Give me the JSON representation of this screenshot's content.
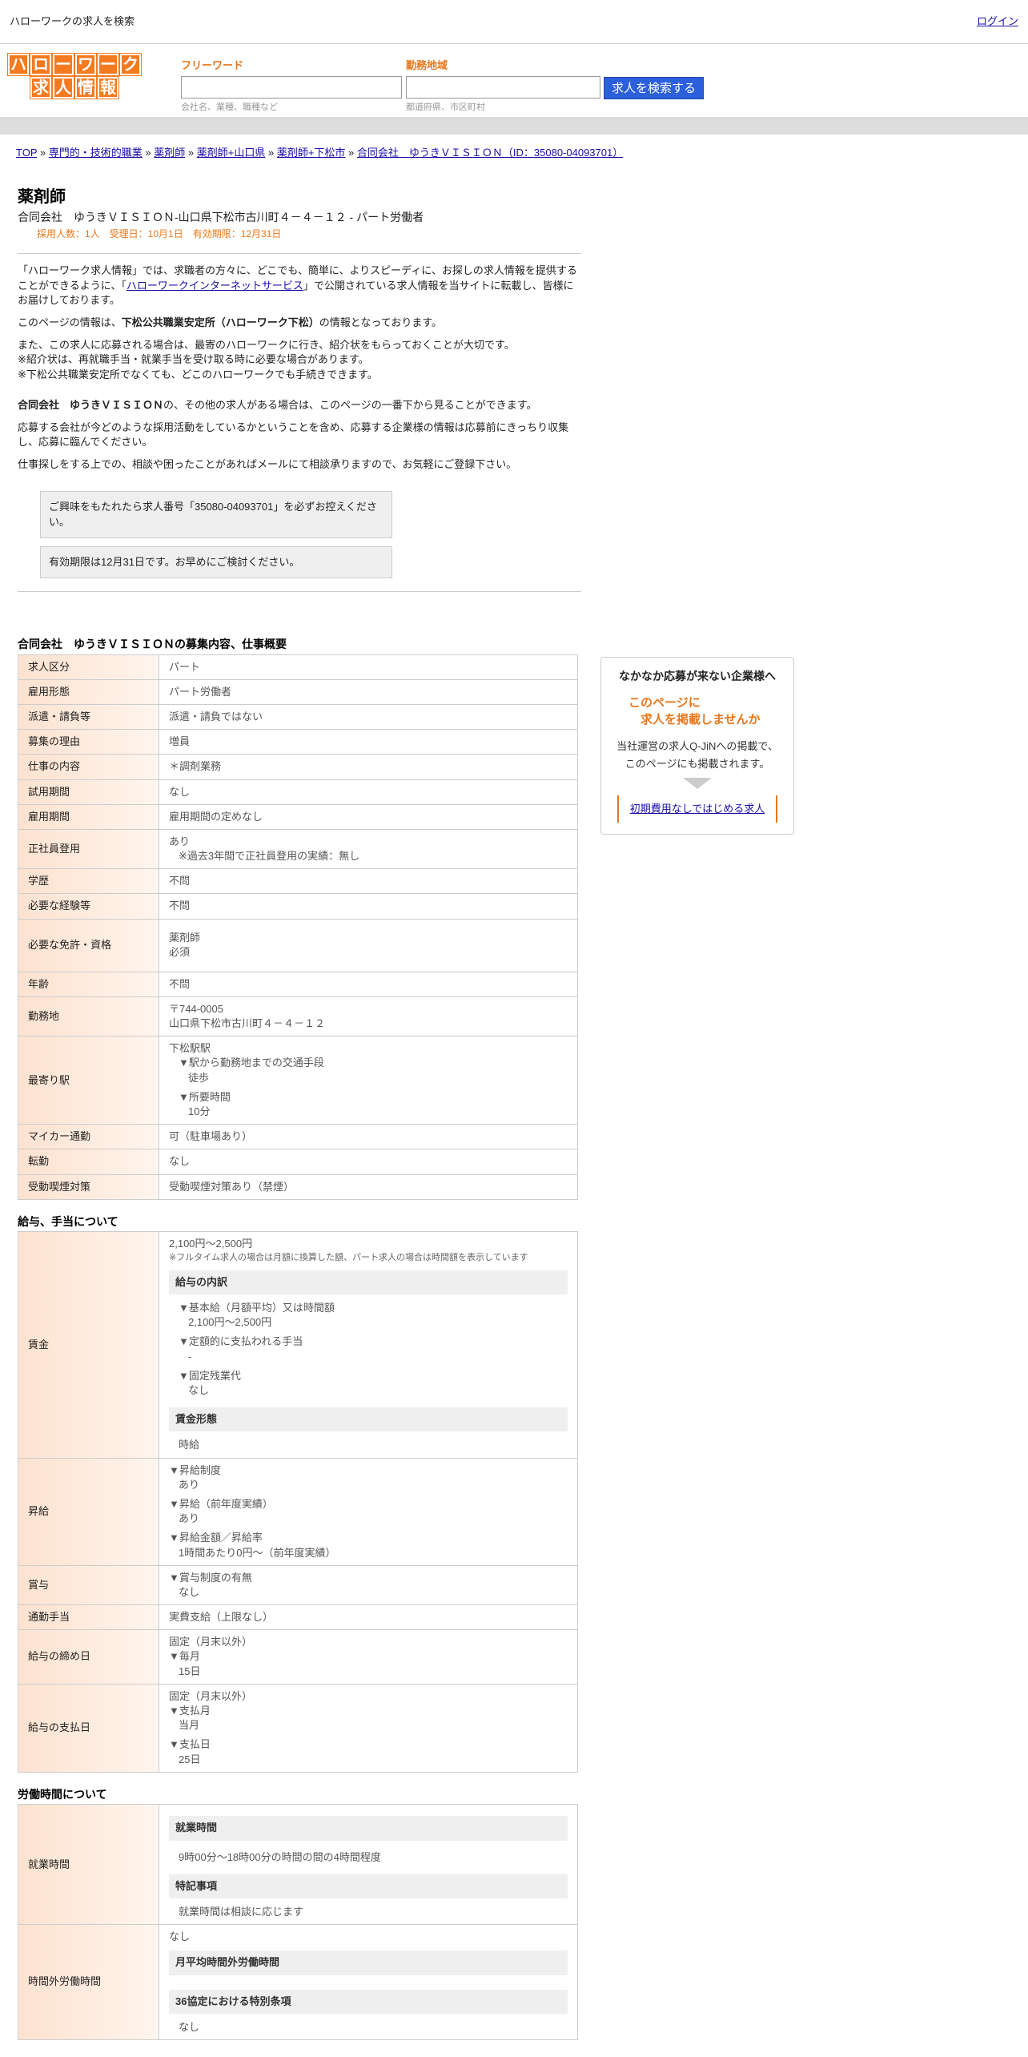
{
  "topbar": {
    "title": "ハローワークの求人を検索",
    "login": "ログイン"
  },
  "logo": {
    "row1": [
      "ハ",
      "ロ",
      "ー",
      "ワ",
      "ー",
      "ク"
    ],
    "row2": [
      "求",
      "人",
      "情",
      "報"
    ]
  },
  "search": {
    "freeword_label": "フリーワード",
    "freeword_value": "",
    "freeword_hint": "会社名、業種、職種など",
    "area_label": "勤務地域",
    "area_value": "",
    "area_hint": "都道府県、市区町村",
    "button": "求人を検索する"
  },
  "breadcrumb": {
    "items": [
      "TOP",
      "専門的・技術的職業",
      "薬剤師",
      "薬剤師+山口県",
      "薬剤師+下松市",
      "合同会社　ゆうきＶＩＳＩＯＮ（ID：35080-04093701）"
    ],
    "sep": "»"
  },
  "job": {
    "title": "薬剤師",
    "subtitle": "合同会社　ゆうきＶＩＳＩＯＮ-山口県下松市古川町４－４－１２ - パート労働者",
    "meta": "採用人数：1人　受理日：10月1日　有効期限：12月31日"
  },
  "intro": {
    "p1_a": "「ハローワーク求人情報」では、求職者の方々に、どこでも、簡単に、よりスピーディに、お探しの求人情報を提供することができるように、「",
    "p1_link": "ハローワークインターネットサービス",
    "p1_b": "」で公開されている求人情報を当サイトに転載し、皆様にお届けしております。",
    "p2_a": "このページの情報は、",
    "p2_bold": "下松公共職業安定所（ハローワーク下松）",
    "p2_b": "の情報となっております。",
    "p3_1": "また、この求人に応募される場合は、最寄のハローワークに行き、紹介状をもらっておくことが大切です。",
    "p3_2": "※紹介状は、再就職手当・就業手当を受け取る時に必要な場合があります。",
    "p3_3": "※下松公共職業安定所でなくても、どこのハローワークでも手続きできます。",
    "p4_bold": "合同会社　ゆうきＶＩＳＩＯＮ",
    "p4_b": "の、その他の求人がある場合は、このページの一番下から見ることができます。",
    "p5": "応募する会社が今どのような採用活動をしているかということを含め、応募する企業様の情報は応募前にきっちり収集し、応募に臨んでください。",
    "p6": "仕事探しをする上での、相談や困ったことがあればメールにて相談承りますので、お気軽にご登録下さい。",
    "notice1": "ご興味をもたれたら求人番号「35080-04093701」を必ずお控えください。",
    "notice2": "有効期限は12月31日です。お早めにご検討ください。"
  },
  "overview": {
    "heading": "合同会社　ゆうきＶＩＳＩＯＮの募集内容、仕事概要",
    "rows": [
      {
        "k": "求人区分",
        "v": "パート"
      },
      {
        "k": "雇用形態",
        "v": "パート労働者"
      },
      {
        "k": "派遣・請負等",
        "v": "派遣・請負ではない"
      },
      {
        "k": "募集の理由",
        "v": "増員"
      },
      {
        "k": "仕事の内容",
        "v": "＊調剤業務"
      },
      {
        "k": "試用期間",
        "v": "なし"
      },
      {
        "k": "雇用期間",
        "v": "雇用期間の定めなし"
      }
    ],
    "seishain_k": "正社員登用",
    "seishain_v1": "あり",
    "seishain_v2": "※過去3年間で正社員登用の実績：無し",
    "rows2": [
      {
        "k": "学歴",
        "v": "不問"
      },
      {
        "k": "必要な経験等",
        "v": "不問"
      }
    ],
    "menkyo_k": "必要な免許・資格",
    "menkyo_v1": "薬剤師",
    "menkyo_v2": "必須",
    "nenrei_k": "年齢",
    "nenrei_v": "不問",
    "kinmu_k": "勤務地",
    "kinmu_v1": "〒744-0005",
    "kinmu_v2": "山口県下松市古川町４－４－１２",
    "eki_k": "最寄り駅",
    "eki_v1": "下松駅駅",
    "eki_v2": "▼駅から勤務地までの交通手段",
    "eki_v3": "徒歩",
    "eki_v4": "▼所要時間",
    "eki_v5": "10分",
    "rows3": [
      {
        "k": "マイカー通勤",
        "v": "可（駐車場あり）"
      },
      {
        "k": "転勤",
        "v": "なし"
      },
      {
        "k": "受動喫煙対策",
        "v": "受動喫煙対策あり（禁煙）"
      }
    ]
  },
  "salary": {
    "heading": "給与、手当について",
    "chingin_k": "賃金",
    "chingin_v1": "2,100円〜2,500円",
    "chingin_note": "※フルタイム求人の場合は月額に換算した額、パート求人の場合は時間額を表示しています",
    "uchiwake_h": "給与の内訳",
    "u1": "▼基本給（月額平均）又は時間額",
    "u1v": "2,100円〜2,500円",
    "u2": "▼定額的に支払われる手当",
    "u2v": "-",
    "u3": "▼固定残業代",
    "u3v": "なし",
    "keitai_h": "賃金形態",
    "keitai_v": "時給",
    "shokyu_k": "昇給",
    "s1": "▼昇給制度",
    "s1v": "あり",
    "s2": "▼昇給（前年度実績）",
    "s2v": "あり",
    "s3": "▼昇給金額／昇給率",
    "s3v": "1時間あたり0円〜（前年度実績）",
    "shoyo_k": "賞与",
    "b1": "▼賞与制度の有無",
    "b1v": "なし",
    "tsukin_k": "通勤手当",
    "tsukin_v": "実費支給（上限なし）",
    "shime_k": "給与の締め日",
    "shime_v1": "固定（月末以外）",
    "shime_v2": "▼毎月",
    "shime_v3": "15日",
    "shiharai_k": "給与の支払日",
    "shiharai_v1": "固定（月末以外）",
    "shiharai_v2": "▼支払月",
    "shiharai_v3": "当月",
    "shiharai_v4": "▼支払日",
    "shiharai_v5": "25日"
  },
  "hours": {
    "heading": "労働時間について",
    "shugyo_k": "就業時間",
    "shugyo_h": "就業時間",
    "shugyo_v": "9時00分〜18時00分の時間の間の4時間程度",
    "tokki_h": "特記事項",
    "tokki_v": "就業時間は相談に応じます",
    "jikangai_k": "時間外労働時間",
    "jikangai_v": "なし",
    "tsukiheikin_h": "月平均時間外労働時間",
    "kyotei_h": "36協定における特別条項",
    "kyotei_v": "なし"
  },
  "side": {
    "heading": "なかなか応募が来ない企業様へ",
    "offer1": "このページに",
    "offer2": "　求人を掲載しませんか",
    "desc1": "当社運営の求人Q-JiNへの掲載で、",
    "desc2": "このページにも掲載されます。",
    "link": "初期費用なしではじめる求人"
  }
}
